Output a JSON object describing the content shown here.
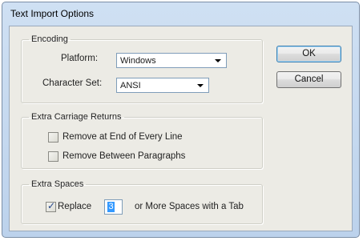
{
  "window": {
    "title": "Text Import Options"
  },
  "encoding": {
    "legend": "Encoding",
    "platform_label": "Platform:",
    "platform_value": "Windows",
    "charset_label": "Character Set:",
    "charset_value": "ANSI"
  },
  "extra_returns": {
    "legend": "Extra Carriage Returns",
    "remove_eol_label": "Remove at End of Every Line",
    "remove_eol_checked": false,
    "remove_para_label": "Remove Between Paragraphs",
    "remove_para_checked": false
  },
  "extra_spaces": {
    "legend": "Extra Spaces",
    "replace_label": "Replace",
    "replace_checked": true,
    "count_value": "3",
    "suffix_label": "or More Spaces with a Tab"
  },
  "buttons": {
    "ok": "OK",
    "cancel": "Cancel"
  }
}
